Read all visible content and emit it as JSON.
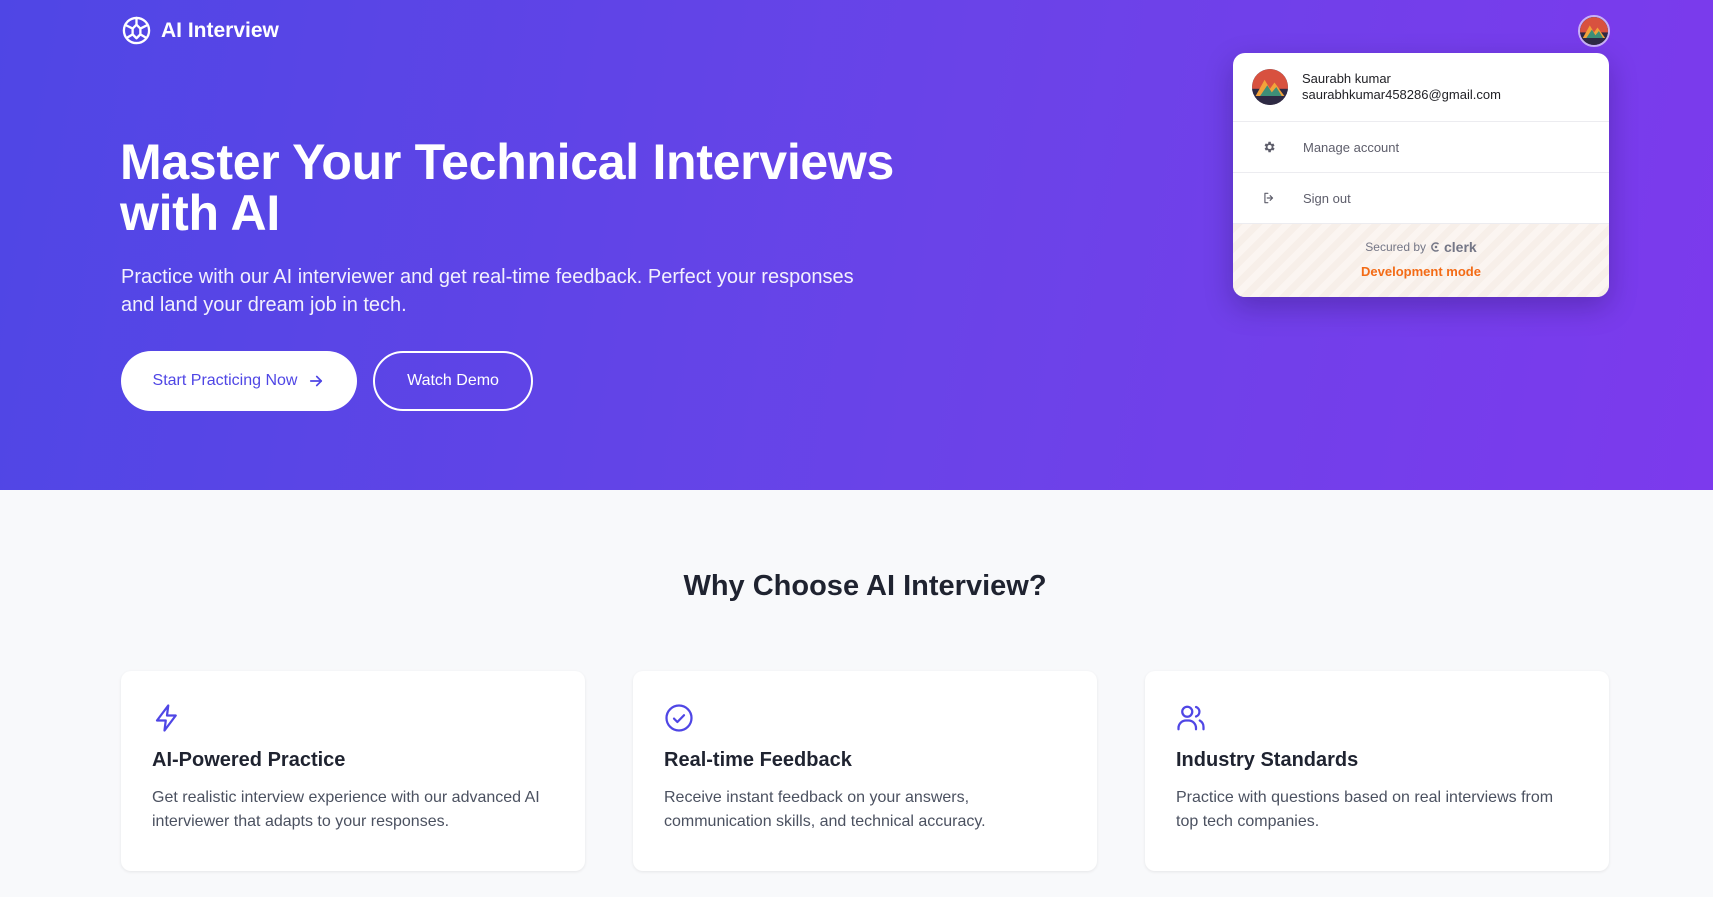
{
  "brand": {
    "name": "AI Interview",
    "logo_icon": "brain-icon"
  },
  "user_avatar_icon": "avatar-mountain-icon",
  "hero": {
    "title": "Master Your Technical Interviews with AI",
    "subtitle": "Practice with our AI interviewer and get real-time feedback. Perfect your responses and land your dream job in tech.",
    "primary_button": "Start Practicing Now",
    "secondary_button": "Watch Demo",
    "gradient_start": "#4f46e5",
    "gradient_end": "#7c3aed"
  },
  "user_menu": {
    "name": "Saurabh kumar",
    "email": "saurabhkumar458286@gmail.com",
    "items": [
      {
        "label": "Manage account",
        "icon": "gear-icon"
      },
      {
        "label": "Sign out",
        "icon": "sign-out-icon"
      }
    ],
    "secured_by": "Secured by",
    "provider": "clerk",
    "mode": "Development mode",
    "mode_color": "#f36b16"
  },
  "features": {
    "title": "Why Choose AI Interview?",
    "accent": "#4f46e5",
    "cards": [
      {
        "icon": "lightning-icon",
        "title": "AI-Powered Practice",
        "desc": "Get realistic interview experience with our advanced AI interviewer that adapts to your responses."
      },
      {
        "icon": "check-circle-icon",
        "title": "Real-time Feedback",
        "desc": "Receive instant feedback on your answers, communication skills, and technical accuracy."
      },
      {
        "icon": "users-icon",
        "title": "Industry Standards",
        "desc": "Practice with questions based on real interviews from top tech companies."
      }
    ]
  }
}
